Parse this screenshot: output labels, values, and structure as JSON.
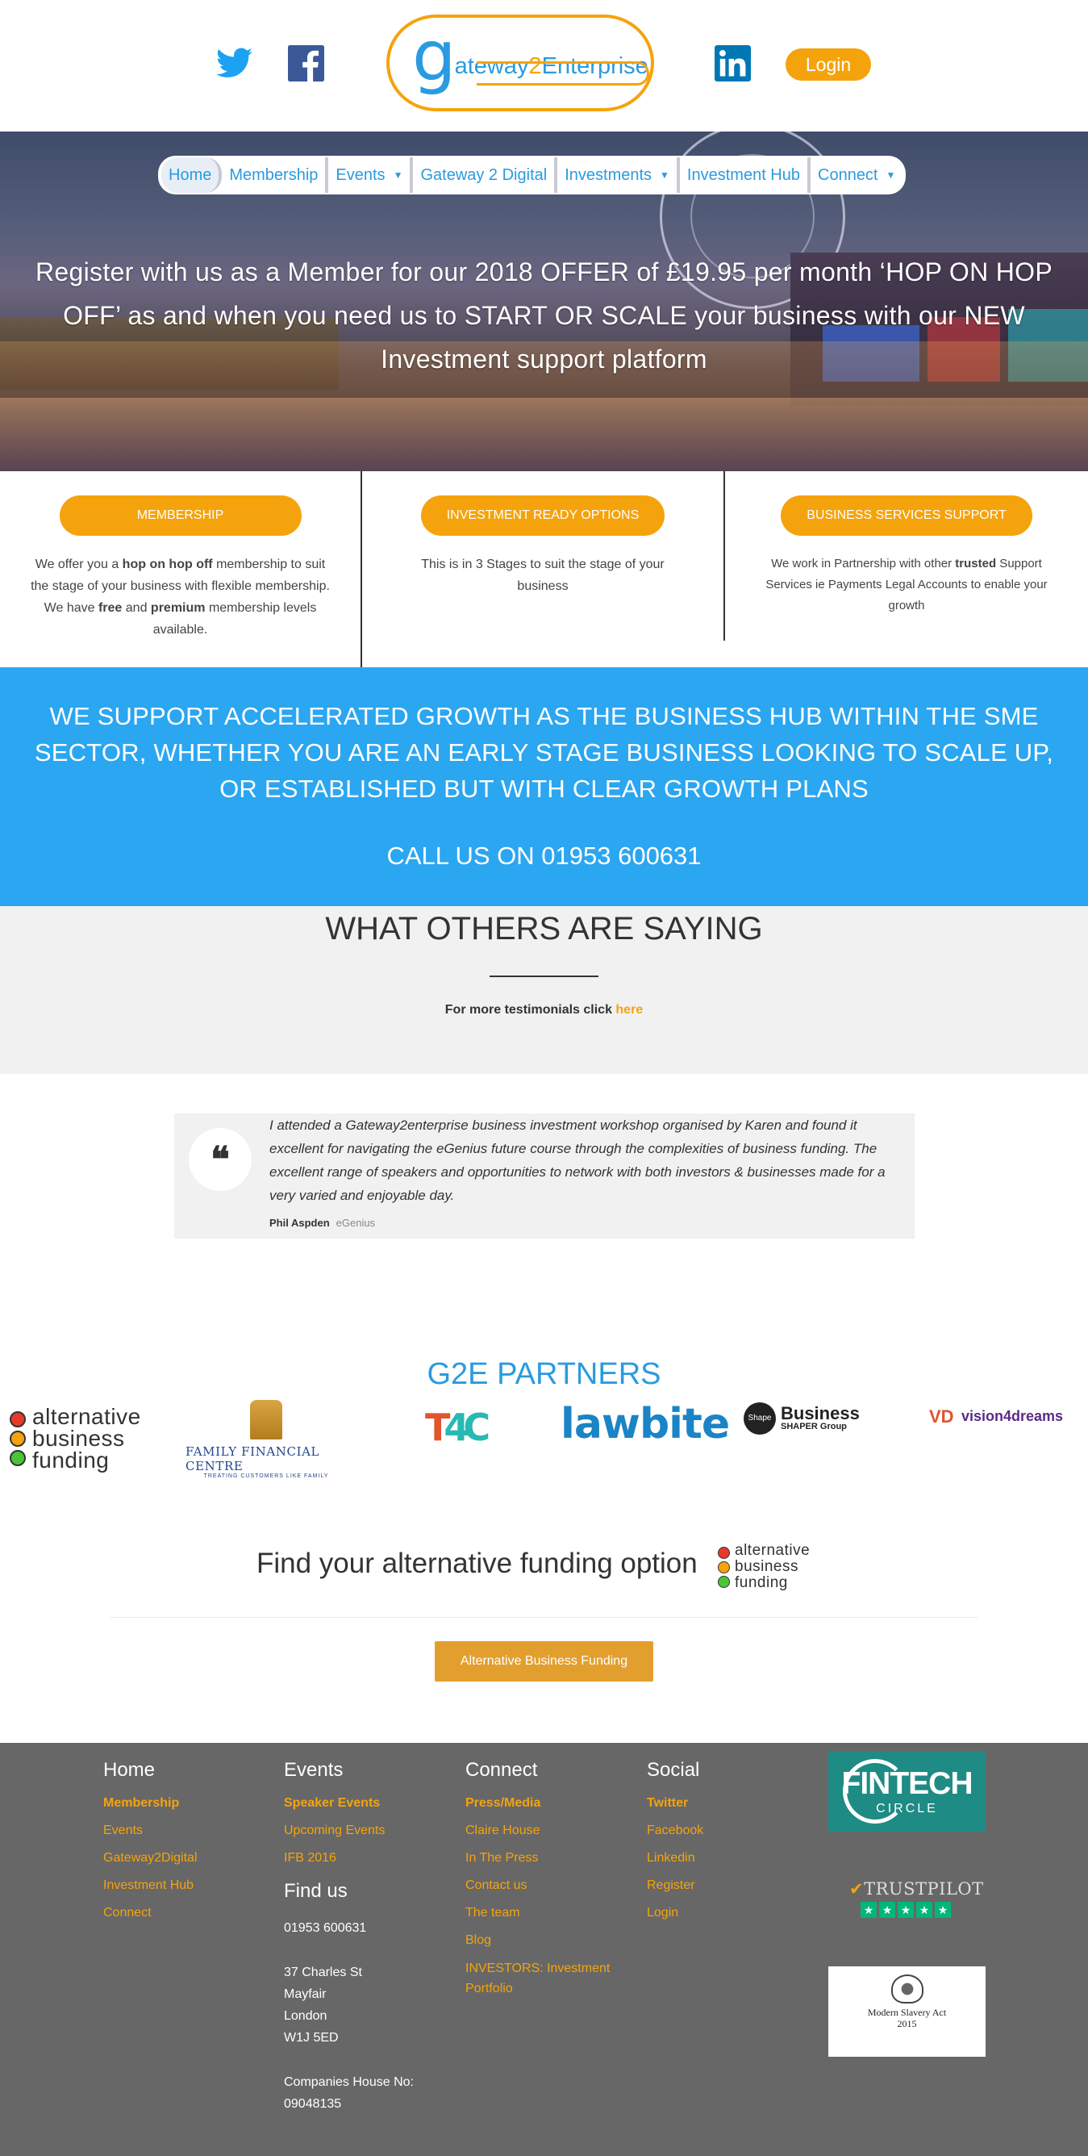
{
  "header": {
    "logo_text": {
      "g": "g",
      "pre": "ateway",
      "two": "2",
      "post": "Enterprise"
    },
    "login_label": "Login",
    "icons": [
      "twitter-icon",
      "facebook-icon",
      "linkedin-icon"
    ]
  },
  "nav": {
    "items": [
      {
        "label": "Home",
        "dropdown": false
      },
      {
        "label": "Membership",
        "dropdown": false
      },
      {
        "label": "Events",
        "dropdown": true
      },
      {
        "label": "Gateway 2 Digital",
        "dropdown": false
      },
      {
        "label": "Investments",
        "dropdown": true
      },
      {
        "label": "Investment Hub",
        "dropdown": false
      },
      {
        "label": "Connect",
        "dropdown": true
      }
    ],
    "caret": "▼"
  },
  "hero": {
    "text": "Register with us as a Member for our 2018 OFFER of £19.95 per month ‘HOP ON HOP OFF’ as and when you need us to START OR SCALE your business with our NEW Investment support platform"
  },
  "features": [
    {
      "button": "MEMBERSHIP",
      "parts": [
        {
          "t": "We offer you a ",
          "b": false
        },
        {
          "t": "hop on hop off",
          "b": true
        },
        {
          "t": " membership to suit the stage of your business with flexible membership. We have ",
          "b": false
        },
        {
          "t": "free",
          "b": true
        },
        {
          "t": " and ",
          "b": false
        },
        {
          "t": "premium",
          "b": true
        },
        {
          "t": " membership levels available.",
          "b": false
        }
      ]
    },
    {
      "button": "INVESTMENT READY OPTIONS",
      "parts": [
        {
          "t": "This is in 3 Stages to suit the stage of your business",
          "b": false
        }
      ]
    },
    {
      "button": "BUSINESS SERVICES SUPPORT",
      "parts": [
        {
          "t": "We work in Partnership with other ",
          "b": false
        },
        {
          "t": "trusted",
          "b": true
        },
        {
          "t": " Support Services ie Payments Legal Accounts to enable your growth",
          "b": false
        }
      ]
    }
  ],
  "band": {
    "main": "WE SUPPORT ACCELERATED GROWTH AS THE BUSINESS HUB WITHIN THE SME SECTOR, WHETHER YOU ARE AN EARLY STAGE BUSINESS LOOKING TO SCALE UP, OR ESTABLISHED BUT WITH CLEAR GROWTH PLANS",
    "call": "CALL US ON 01953 600631"
  },
  "testimonials": {
    "title": "WHAT OTHERS ARE SAYING",
    "more_prefix": "For more testimonials click ",
    "more_link": "here",
    "quote_mark": "❝",
    "quote": "I attended a Gateway2enterprise business investment workshop organised by Karen and found it excellent for navigating the eGenius future course through the complexities of business funding. The excellent range of speakers and opportunities to network with both investors & businesses made for a very varied and enjoyable day.",
    "author": "Phil Aspden",
    "company": "eGenius"
  },
  "partners": {
    "title": "G2E PARTNERS",
    "abf": [
      "alternative",
      "business",
      "funding"
    ],
    "ffc_name": "FAMILY FINANCIAL CENTRE",
    "ffc_sub": "TREATING CUSTOMERS LIKE FAMILY",
    "t4c": {
      "a": "T",
      "b": "4C"
    },
    "lawbite": "lawbite",
    "bs": {
      "badge": "Shape",
      "name": "Business",
      "sub": "SHAPER Group"
    },
    "v4d": {
      "mark": "VD",
      "name": "vision4dreams"
    }
  },
  "find": {
    "title": "Find your alternative funding option",
    "button": "Alternative Business Funding"
  },
  "footer": {
    "cols": [
      {
        "head": "Home",
        "links": [
          "Membership",
          "Events",
          "Gateway2Digital",
          "Investment Hub",
          "Connect"
        ]
      },
      {
        "head": "Events",
        "links": [
          "Speaker Events",
          "Upcoming Events",
          "IFB 2016"
        ]
      },
      {
        "head": "Connect",
        "links": [
          "Press/Media",
          "Claire House",
          "In The Press",
          "Contact us",
          "The team",
          "Blog",
          "INVESTORS: Investment Portfolio"
        ]
      },
      {
        "head": "Social",
        "links": [
          "Twitter",
          "Facebook",
          "Linkedin",
          "Register",
          "Login"
        ]
      }
    ],
    "find_us": {
      "head": "Find us",
      "phone": "01953 600631",
      "address": [
        "37 Charles St",
        "Mayfair",
        "London",
        "W1J 5ED"
      ],
      "companies_label": "Companies House No:",
      "companies_no": "09048135"
    },
    "fintech": {
      "big": "FINTECH",
      "small": "CIRCLE"
    },
    "trustpilot": {
      "check": "✔",
      "name": "TRUSTPILOT",
      "stars": [
        "★",
        "★",
        "★",
        "★",
        "★"
      ]
    },
    "msa": [
      "Modern Slavery Act",
      "2015"
    ]
  },
  "colors": {
    "accent_blue": "#2a9be0",
    "orange": "#f5a30c",
    "band_blue": "#2ba6f1",
    "footer_grey": "#676767"
  }
}
